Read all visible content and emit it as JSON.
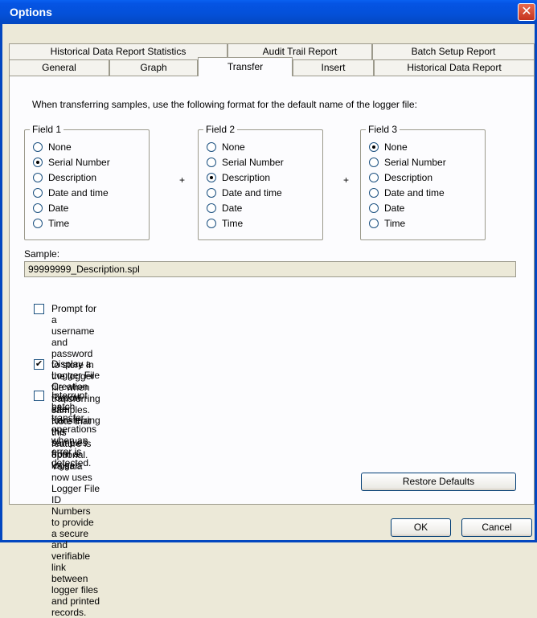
{
  "window": {
    "title": "Options",
    "close_symbol": "✕"
  },
  "tabs_row1": [
    "Historical Data Report Statistics",
    "Audit Trail Report",
    "Batch Setup Report"
  ],
  "tabs_row2": [
    "General",
    "Graph",
    "Transfer",
    "Insert",
    "Historical Data Report"
  ],
  "active_tab": "Transfer",
  "transfer": {
    "intro": "When transferring samples, use the following format for the default name of the logger file:",
    "plus": "+",
    "fields": [
      {
        "legend": "Field 1",
        "options": [
          "None",
          "Serial Number",
          "Description",
          "Date and time",
          "Date",
          "Time"
        ],
        "selected": "Serial Number"
      },
      {
        "legend": "Field 2",
        "options": [
          "None",
          "Serial Number",
          "Description",
          "Date and time",
          "Date",
          "Time"
        ],
        "selected": "Description"
      },
      {
        "legend": "Field 3",
        "options": [
          "None",
          "Serial Number",
          "Description",
          "Date and time",
          "Date",
          "Time"
        ],
        "selected": "None"
      }
    ],
    "sample_label": "Sample:",
    "sample_value": "99999999_Description.spl",
    "checkboxes": [
      {
        "label_lines": [
          "Prompt for a username and password to store in the logger file when transferring samples. Note that this",
          "feature is optional. Vaisala now uses Logger File ID Numbers to provide a secure and verifiable link",
          "between logger files and printed records."
        ],
        "checked": false
      },
      {
        "label_lines": [
          "Display a Logger File Creation Report after transferring the samples from a logger."
        ],
        "checked": true
      },
      {
        "label_lines": [
          "Interrupt batch transfer operations when an error is detected."
        ],
        "checked": false
      }
    ],
    "check_mark": "✔",
    "restore_defaults": "Restore Defaults"
  },
  "buttons": {
    "ok": "OK",
    "cancel": "Cancel"
  }
}
